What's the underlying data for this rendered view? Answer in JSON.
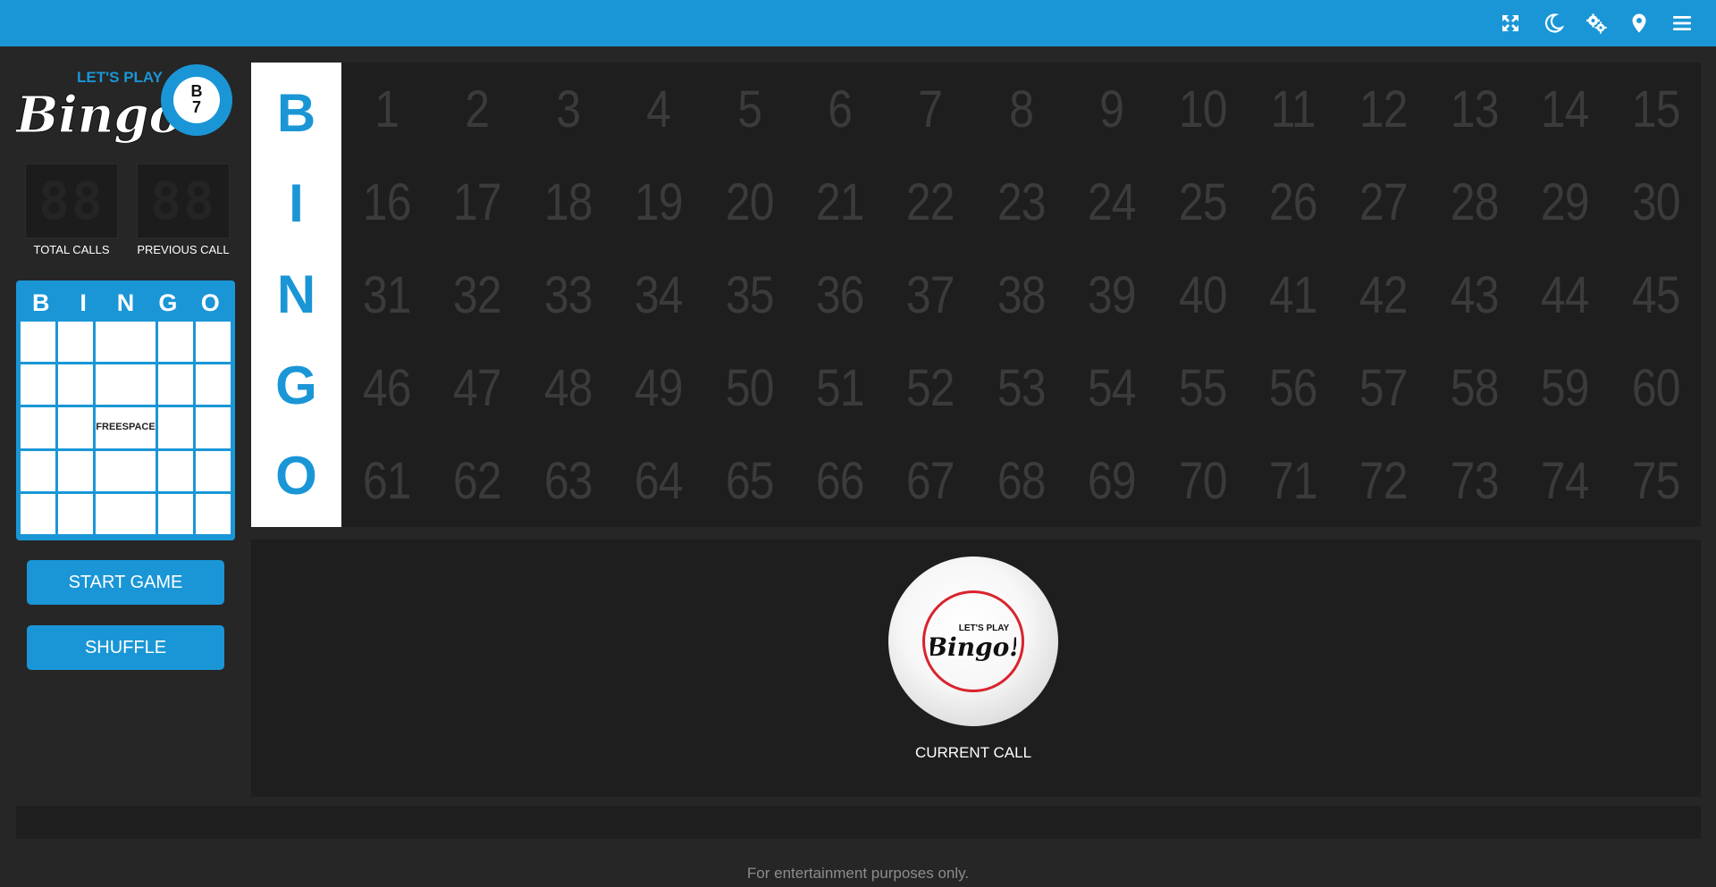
{
  "topbar": {
    "icons": [
      "fullscreen-icon",
      "moon-icon",
      "gears-icon",
      "location-icon",
      "menu-icon"
    ],
    "color": "#1a96d6"
  },
  "logo": {
    "top_text": "LET'S PLAY",
    "main_text": "Bingo!",
    "ball_letter": "B",
    "ball_number": "7"
  },
  "counters": {
    "total_calls": {
      "display": "88",
      "label": "TOTAL CALLS"
    },
    "previous_call": {
      "display": "88",
      "label": "PREVIOUS CALL"
    }
  },
  "mini_card": {
    "header": [
      "B",
      "I",
      "N",
      "G",
      "O"
    ],
    "free_space_line1": "FREE",
    "free_space_line2": "SPACE"
  },
  "buttons": {
    "start": "START GAME",
    "shuffle": "SHUFFLE"
  },
  "board": {
    "letters": [
      "B",
      "I",
      "N",
      "G",
      "O"
    ],
    "numbers": [
      [
        "1",
        "2",
        "3",
        "4",
        "5",
        "6",
        "7",
        "8",
        "9",
        "10",
        "11",
        "12",
        "13",
        "14",
        "15"
      ],
      [
        "16",
        "17",
        "18",
        "19",
        "20",
        "21",
        "22",
        "23",
        "24",
        "25",
        "26",
        "27",
        "28",
        "29",
        "30"
      ],
      [
        "31",
        "32",
        "33",
        "34",
        "35",
        "36",
        "37",
        "38",
        "39",
        "40",
        "41",
        "42",
        "43",
        "44",
        "45"
      ],
      [
        "46",
        "47",
        "48",
        "49",
        "50",
        "51",
        "52",
        "53",
        "54",
        "55",
        "56",
        "57",
        "58",
        "59",
        "60"
      ],
      [
        "61",
        "62",
        "63",
        "64",
        "65",
        "66",
        "67",
        "68",
        "69",
        "70",
        "71",
        "72",
        "73",
        "74",
        "75"
      ]
    ]
  },
  "current_call": {
    "label": "CURRENT CALL",
    "ball_top_text": "LET'S PLAY",
    "ball_main_text": "Bingo!"
  },
  "footer": {
    "text": "For entertainment purposes only."
  },
  "colors": {
    "accent": "#1a96d6",
    "background": "#262626",
    "panel": "#1e1e1e",
    "ball_ring": "#d9232d"
  }
}
